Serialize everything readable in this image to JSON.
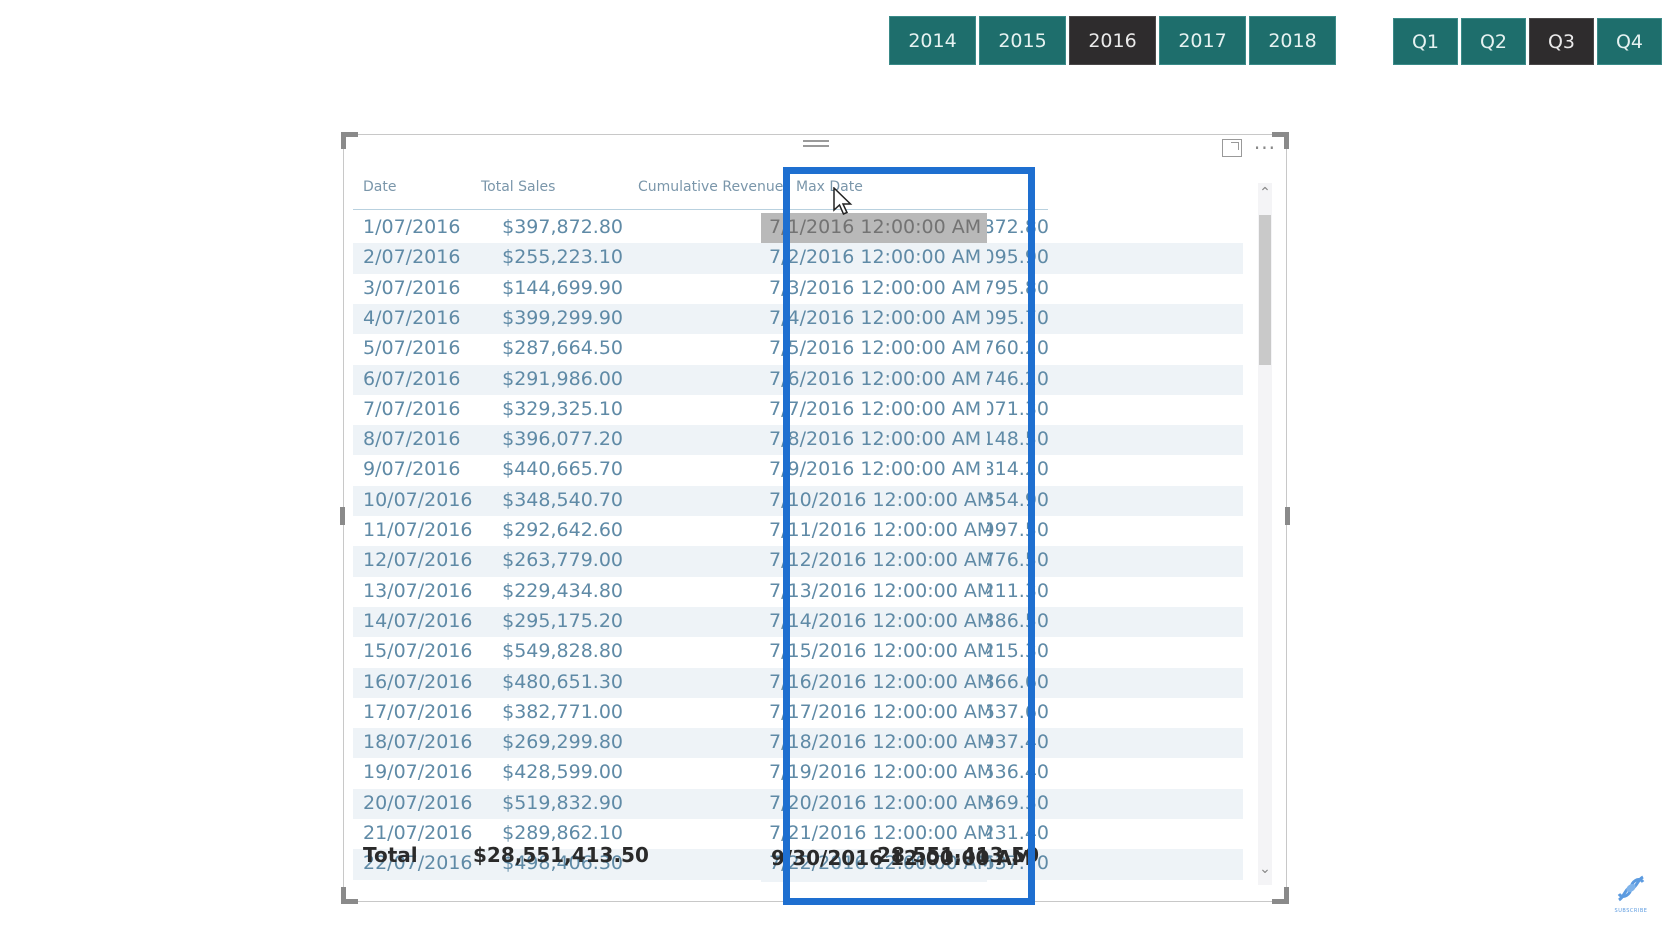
{
  "year_slicer": {
    "options": [
      "2014",
      "2015",
      "2016",
      "2017",
      "2018"
    ],
    "selected": "2016"
  },
  "quarter_slicer": {
    "options": [
      "Q1",
      "Q2",
      "Q3",
      "Q4"
    ],
    "selected": "Q3"
  },
  "colors": {
    "slicer_bg": "#1e6e6c",
    "slicer_selected_bg": "#2e2c2d",
    "highlight_border": "#1e6fd0",
    "table_text": "#5f8aa6"
  },
  "table": {
    "columns": [
      "Date",
      "Total Sales",
      "Cumulative Revenue",
      "Max Date"
    ],
    "rows": [
      [
        "1/07/2016",
        "$397,872.80",
        "397,872.80",
        "7/1/2016 12:00:00 AM"
      ],
      [
        "2/07/2016",
        "$255,223.10",
        "653,095.90",
        "7/2/2016 12:00:00 AM"
      ],
      [
        "3/07/2016",
        "$144,699.90",
        "797,795.80",
        "7/3/2016 12:00:00 AM"
      ],
      [
        "4/07/2016",
        "$399,299.90",
        "1,197,095.70",
        "7/4/2016 12:00:00 AM"
      ],
      [
        "5/07/2016",
        "$287,664.50",
        "1,484,760.20",
        "7/5/2016 12:00:00 AM"
      ],
      [
        "6/07/2016",
        "$291,986.00",
        "1,776,746.20",
        "7/6/2016 12:00:00 AM"
      ],
      [
        "7/07/2016",
        "$329,325.10",
        "2,106,071.30",
        "7/7/2016 12:00:00 AM"
      ],
      [
        "8/07/2016",
        "$396,077.20",
        "2,502,148.50",
        "7/8/2016 12:00:00 AM"
      ],
      [
        "9/07/2016",
        "$440,665.70",
        "2,942,814.20",
        "7/9/2016 12:00:00 AM"
      ],
      [
        "10/07/2016",
        "$348,540.70",
        "3,291,354.90",
        "7/10/2016 12:00:00 AM"
      ],
      [
        "11/07/2016",
        "$292,642.60",
        "3,583,997.50",
        "7/11/2016 12:00:00 AM"
      ],
      [
        "12/07/2016",
        "$263,779.00",
        "3,847,776.50",
        "7/12/2016 12:00:00 AM"
      ],
      [
        "13/07/2016",
        "$229,434.80",
        "4,077,211.30",
        "7/13/2016 12:00:00 AM"
      ],
      [
        "14/07/2016",
        "$295,175.20",
        "4,372,386.50",
        "7/14/2016 12:00:00 AM"
      ],
      [
        "15/07/2016",
        "$549,828.80",
        "4,922,215.30",
        "7/15/2016 12:00:00 AM"
      ],
      [
        "16/07/2016",
        "$480,651.30",
        "5,402,866.60",
        "7/16/2016 12:00:00 AM"
      ],
      [
        "17/07/2016",
        "$382,771.00",
        "5,785,637.60",
        "7/17/2016 12:00:00 AM"
      ],
      [
        "18/07/2016",
        "$269,299.80",
        "6,054,937.40",
        "7/18/2016 12:00:00 AM"
      ],
      [
        "19/07/2016",
        "$428,599.00",
        "6,483,536.40",
        "7/19/2016 12:00:00 AM"
      ],
      [
        "20/07/2016",
        "$519,832.90",
        "7,003,369.30",
        "7/20/2016 12:00:00 AM"
      ],
      [
        "21/07/2016",
        "$289,862.10",
        "7,293,231.40",
        "7/21/2016 12:00:00 AM"
      ],
      [
        "22/07/2016",
        "$498,406.30",
        "7,791,637.70",
        "7/22/2016 12:00:00 AM"
      ]
    ],
    "total": [
      "Total",
      "$28,551,413.50",
      "28,551,413.50",
      "9/30/2016 12:00:00 AM"
    ]
  },
  "icons": {
    "focus_mode": "focus-mode-icon",
    "more_options": "more-options-icon",
    "scroll_up": "^",
    "scroll_down": "v"
  },
  "logo": {
    "text": "SUBSCRIBE"
  }
}
